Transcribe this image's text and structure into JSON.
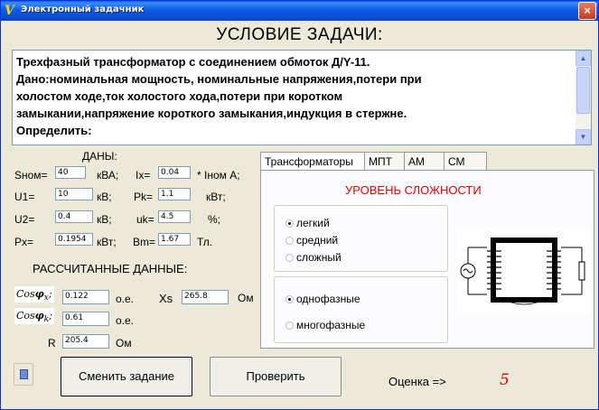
{
  "window": {
    "title": "Электронный задачник",
    "icon": "app-logo-icon",
    "close": "×"
  },
  "heading": "УСЛОВИЕ ЗАДАЧИ:",
  "task": {
    "lines": [
      "Трехфазный трансформатор с соединением обмоток Д/Y-11.",
      "Дано:номинальная мощность, номинальные напряжения,потери при",
      "холостом ходе,ток холостого хода,потери при коротком",
      "замыкании,напряжение короткого замыкания,индукция в стержне.",
      "Определить:"
    ]
  },
  "given": {
    "title": "ДАНЫ:",
    "snom": {
      "label": "Sном=",
      "value": "40",
      "unit": "кВА;"
    },
    "ix": {
      "label": "Ix=",
      "value": "0.04",
      "unit": "* Iном А;"
    },
    "u1": {
      "label": "U1=",
      "value": "10",
      "unit": "кВ;"
    },
    "pk": {
      "label": "Pk=",
      "value": "1.1",
      "unit": "кВт;"
    },
    "u2": {
      "label": "U2=",
      "value": "0.4",
      "unit": "кВ;"
    },
    "uk": {
      "label": "uk=",
      "value": "4.5",
      "unit": "%;"
    },
    "px": {
      "label": "Px=",
      "value": "0.1954",
      "unit": "кВт;"
    },
    "bm": {
      "label": "Bm=",
      "value": "1.67",
      "unit": "Тл."
    }
  },
  "computed": {
    "title": "РАССЧИТАННЫЕ ДАННЫЕ:",
    "cos_x": {
      "label": "Cos",
      "sub": "x",
      "value": "0.122",
      "unit": "о.е."
    },
    "xs": {
      "label": "Xs",
      "value": "265.8",
      "unit": "Ом"
    },
    "cos_k": {
      "label": "Cos",
      "sub": "k",
      "value": "0.61",
      "unit": "о.е."
    },
    "r": {
      "label": "R",
      "value": "205.4",
      "unit": "Ом"
    }
  },
  "tabs": [
    {
      "label": "Трансформаторы",
      "active": true
    },
    {
      "label": "МПТ",
      "active": false
    },
    {
      "label": "АМ",
      "active": false
    },
    {
      "label": "СМ",
      "active": false
    }
  ],
  "difficulty": {
    "title": "УРОВЕНЬ СЛОЖНОСТИ",
    "options": [
      {
        "label": "легкий",
        "selected": true
      },
      {
        "label": "средний",
        "selected": false
      },
      {
        "label": "сложный",
        "selected": false
      }
    ]
  },
  "phase": {
    "options": [
      {
        "label": "однофазные",
        "selected": true
      },
      {
        "label": "многофазные",
        "selected": false
      }
    ]
  },
  "buttons": {
    "change": "Сменить задание",
    "check": "Проверить"
  },
  "grade": {
    "label": "Оценка =>",
    "value": "5"
  },
  "colors": {
    "accent_red": "#e00000",
    "window_bg": "#ece9d8",
    "title_blue": "#0a5fe6"
  }
}
